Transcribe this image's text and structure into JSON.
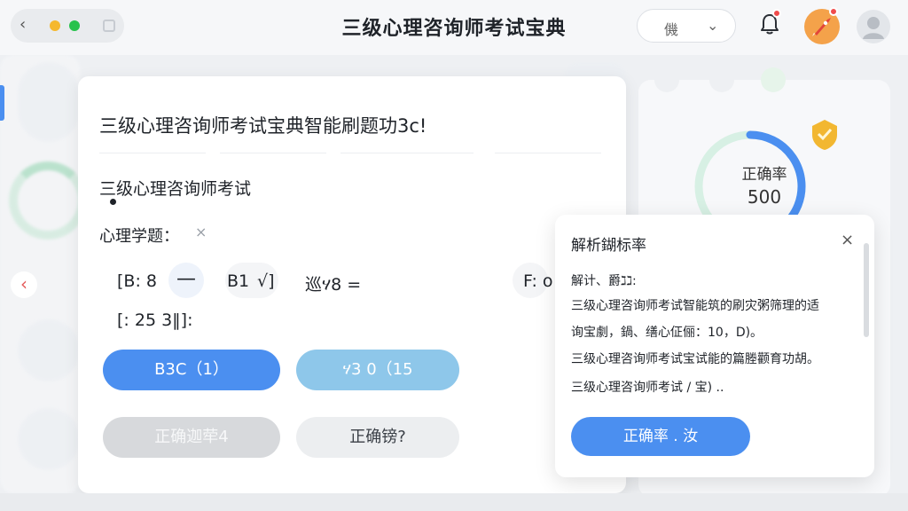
{
  "window": {
    "title": "三级心理咨询师考试宝典",
    "language_value": "僟"
  },
  "main_card": {
    "title": "三级心理咨询师考试宝典智能刷题功3c!",
    "exam_name": "三级心理咨询师考试",
    "question_label": "心理学题：",
    "question_close": "×",
    "option_line1": {
      "a": "[B: 8",
      "a_chip": "—",
      "b": "B1",
      "b_mark": "√]",
      "c": "巡ሃ8 =",
      "d": "F: o"
    },
    "option_line2": "[: 25 3‖]:",
    "buttons": {
      "answer_b": "B3C（1）",
      "answer_c": "ሃ3 0（15",
      "correct_rate": "正确迦荦4",
      "correct_wrong": "正确镑?"
    }
  },
  "stats_card": {
    "ring_label": "正确率",
    "ring_value": "500",
    "colors": {
      "ring": "#4b8ff0",
      "ring_track": "#d7f0e4",
      "shield": "#f2b731"
    }
  },
  "popover": {
    "title": "解析鍸标率",
    "close": "×",
    "lines": [
      "解计、爵ℷℷ:",
      "三级心理咨询师考试智能筑的刷灾粥筛理的适",
      "询宝劇，鍋、缮心佂俪：10，D)。",
      "三级心理咨询师考试宝试能的篇塍颧育功胡。",
      "三级心理咨询师考试 / 宝) .."
    ],
    "button": "正确率 . 汝"
  },
  "icons": {
    "back": "chevron-left-icon",
    "bell": "bell-icon",
    "rocket": "rocket-icon",
    "avatar": "user-avatar-icon",
    "shield": "shield-badge-icon"
  }
}
